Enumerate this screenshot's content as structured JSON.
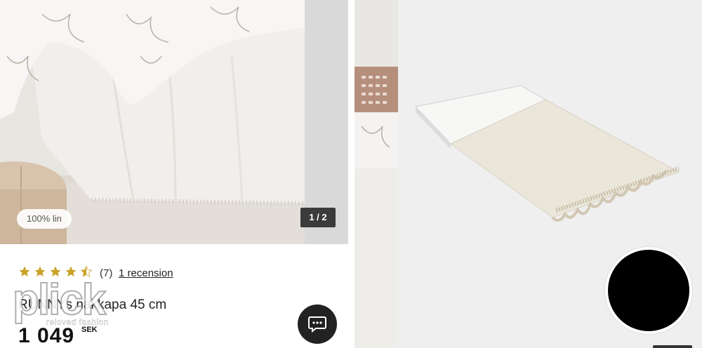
{
  "gallery": {
    "badge": "100% lin",
    "counter": "1 / 2"
  },
  "product": {
    "rating_count": "(7)",
    "review_link": "1 recension",
    "title": "RUNNYs nakkapa 45 cm",
    "price": "1 049",
    "currency": "SEK",
    "rating": 4.5
  },
  "watermark": {
    "brand": "plick",
    "tagline": "reloved fashion"
  },
  "icons": {
    "chat": "chat-bubble-icon",
    "star": "star-icon"
  },
  "colors": {
    "star": "#c9a227",
    "chat_bg": "#222222",
    "counter_bg": "#3b3b3b"
  }
}
